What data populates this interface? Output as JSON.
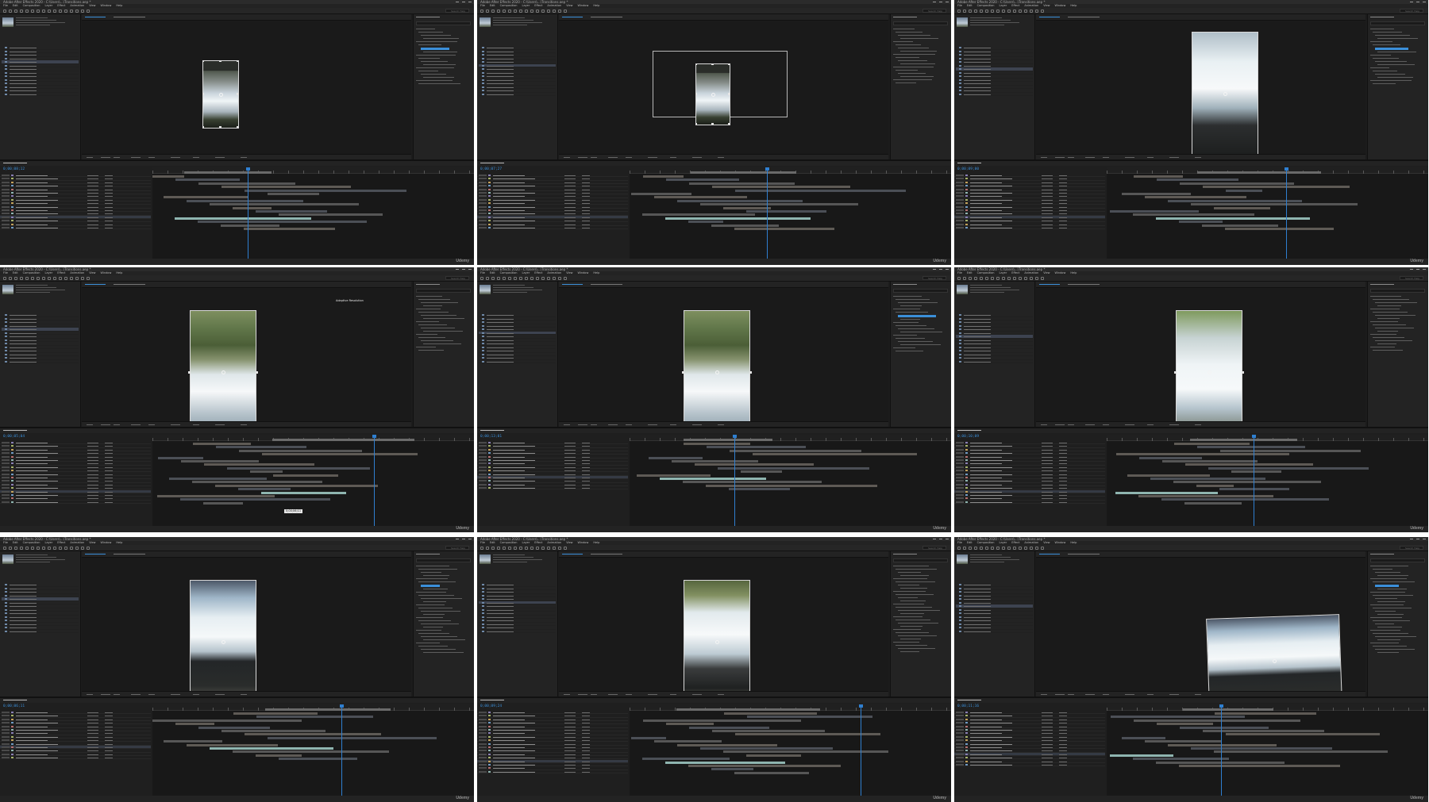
{
  "grid": {
    "columns": 3,
    "rows": 3,
    "watermark": "Udemy",
    "cells": [
      {
        "title": "Adobe After Effects 2020 - C:\\Users\\...\\Transitions.aep *",
        "menu": [
          "File",
          "Edit",
          "Composition",
          "Layer",
          "Effect",
          "Animation",
          "View",
          "Window",
          "Help"
        ],
        "timecode": "0;00;08;12",
        "image": "img-a"
      },
      {
        "title": "Adobe After Effects 2020 - C:\\Users\\...\\Transitions.aep *",
        "menu": [
          "File",
          "Edit",
          "Composition",
          "Layer",
          "Effect",
          "Animation",
          "View",
          "Window",
          "Help"
        ],
        "timecode": "0;00;07;27",
        "image": "img-a"
      },
      {
        "title": "Adobe After Effects 2020 - C:\\Users\\...\\Transitions.aep *",
        "menu": [
          "File",
          "Edit",
          "Composition",
          "Layer",
          "Effect",
          "Animation",
          "View",
          "Window",
          "Help"
        ],
        "timecode": "0;00;09;00",
        "image": "img-e"
      },
      {
        "title": "Adobe After Effects 2020 - C:\\Users\\...\\Transitions.aep *",
        "menu": [
          "File",
          "Edit",
          "Composition",
          "Layer",
          "Effect",
          "Animation",
          "View",
          "Window",
          "Help"
        ],
        "timecode": "0;00;05;04",
        "image": "img-b"
      },
      {
        "title": "Adobe After Effects 2020 - C:\\Users\\...\\Transitions.aep *",
        "menu": [
          "File",
          "Edit",
          "Composition",
          "Layer",
          "Effect",
          "Animation",
          "View",
          "Window",
          "Help"
        ],
        "timecode": "0;00;13;01",
        "image": "img-b"
      },
      {
        "title": "Adobe After Effects 2020 - C:\\Users\\...\\Transitions.aep *",
        "menu": [
          "File",
          "Edit",
          "Composition",
          "Layer",
          "Effect",
          "Animation",
          "View",
          "Window",
          "Help"
        ],
        "timecode": "0;00;10;09",
        "image": "img-f"
      },
      {
        "title": "Adobe After Effects 2020 - C:\\Users\\...\\Transitions.aep *",
        "menu": [
          "File",
          "Edit",
          "Composition",
          "Layer",
          "Effect",
          "Animation",
          "View",
          "Window",
          "Help"
        ],
        "timecode": "0;00;06;11",
        "image": "img-c"
      },
      {
        "title": "Adobe After Effects 2020 - C:\\Users\\...\\Transitions.aep *",
        "menu": [
          "File",
          "Edit",
          "Composition",
          "Layer",
          "Effect",
          "Animation",
          "View",
          "Window",
          "Help"
        ],
        "timecode": "0;00;09;24",
        "image": "img-d"
      },
      {
        "title": "Adobe After Effects 2020 - C:\\Users\\...\\Transitions.aep *",
        "menu": [
          "File",
          "Edit",
          "Composition",
          "Layer",
          "Effect",
          "Animation",
          "View",
          "Window",
          "Help"
        ],
        "timecode": "0;00;11;16",
        "image": "img-c"
      }
    ]
  },
  "search_placeholder": "Search Help",
  "viewer_label": "Adaptive Resolution",
  "tooltip_time": "0;00;06;11",
  "colors": {
    "accent": "#3b8fd9",
    "panel": "#232323",
    "track_video": "#8fb5b0",
    "track_comp": "#a08e80"
  }
}
